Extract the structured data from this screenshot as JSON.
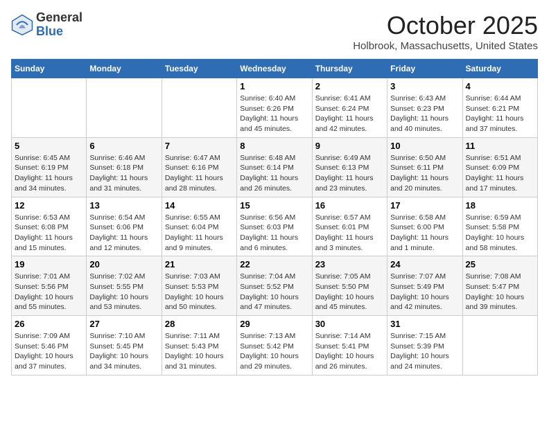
{
  "header": {
    "logo_general": "General",
    "logo_blue": "Blue",
    "month_title": "October 2025",
    "location": "Holbrook, Massachusetts, United States"
  },
  "days_of_week": [
    "Sunday",
    "Monday",
    "Tuesday",
    "Wednesday",
    "Thursday",
    "Friday",
    "Saturday"
  ],
  "weeks": [
    [
      {
        "day": "",
        "info": ""
      },
      {
        "day": "",
        "info": ""
      },
      {
        "day": "",
        "info": ""
      },
      {
        "day": "1",
        "info": "Sunrise: 6:40 AM\nSunset: 6:26 PM\nDaylight: 11 hours\nand 45 minutes."
      },
      {
        "day": "2",
        "info": "Sunrise: 6:41 AM\nSunset: 6:24 PM\nDaylight: 11 hours\nand 42 minutes."
      },
      {
        "day": "3",
        "info": "Sunrise: 6:43 AM\nSunset: 6:23 PM\nDaylight: 11 hours\nand 40 minutes."
      },
      {
        "day": "4",
        "info": "Sunrise: 6:44 AM\nSunset: 6:21 PM\nDaylight: 11 hours\nand 37 minutes."
      }
    ],
    [
      {
        "day": "5",
        "info": "Sunrise: 6:45 AM\nSunset: 6:19 PM\nDaylight: 11 hours\nand 34 minutes."
      },
      {
        "day": "6",
        "info": "Sunrise: 6:46 AM\nSunset: 6:18 PM\nDaylight: 11 hours\nand 31 minutes."
      },
      {
        "day": "7",
        "info": "Sunrise: 6:47 AM\nSunset: 6:16 PM\nDaylight: 11 hours\nand 28 minutes."
      },
      {
        "day": "8",
        "info": "Sunrise: 6:48 AM\nSunset: 6:14 PM\nDaylight: 11 hours\nand 26 minutes."
      },
      {
        "day": "9",
        "info": "Sunrise: 6:49 AM\nSunset: 6:13 PM\nDaylight: 11 hours\nand 23 minutes."
      },
      {
        "day": "10",
        "info": "Sunrise: 6:50 AM\nSunset: 6:11 PM\nDaylight: 11 hours\nand 20 minutes."
      },
      {
        "day": "11",
        "info": "Sunrise: 6:51 AM\nSunset: 6:09 PM\nDaylight: 11 hours\nand 17 minutes."
      }
    ],
    [
      {
        "day": "12",
        "info": "Sunrise: 6:53 AM\nSunset: 6:08 PM\nDaylight: 11 hours\nand 15 minutes."
      },
      {
        "day": "13",
        "info": "Sunrise: 6:54 AM\nSunset: 6:06 PM\nDaylight: 11 hours\nand 12 minutes."
      },
      {
        "day": "14",
        "info": "Sunrise: 6:55 AM\nSunset: 6:04 PM\nDaylight: 11 hours\nand 9 minutes."
      },
      {
        "day": "15",
        "info": "Sunrise: 6:56 AM\nSunset: 6:03 PM\nDaylight: 11 hours\nand 6 minutes."
      },
      {
        "day": "16",
        "info": "Sunrise: 6:57 AM\nSunset: 6:01 PM\nDaylight: 11 hours\nand 3 minutes."
      },
      {
        "day": "17",
        "info": "Sunrise: 6:58 AM\nSunset: 6:00 PM\nDaylight: 11 hours\nand 1 minute."
      },
      {
        "day": "18",
        "info": "Sunrise: 6:59 AM\nSunset: 5:58 PM\nDaylight: 10 hours\nand 58 minutes."
      }
    ],
    [
      {
        "day": "19",
        "info": "Sunrise: 7:01 AM\nSunset: 5:56 PM\nDaylight: 10 hours\nand 55 minutes."
      },
      {
        "day": "20",
        "info": "Sunrise: 7:02 AM\nSunset: 5:55 PM\nDaylight: 10 hours\nand 53 minutes."
      },
      {
        "day": "21",
        "info": "Sunrise: 7:03 AM\nSunset: 5:53 PM\nDaylight: 10 hours\nand 50 minutes."
      },
      {
        "day": "22",
        "info": "Sunrise: 7:04 AM\nSunset: 5:52 PM\nDaylight: 10 hours\nand 47 minutes."
      },
      {
        "day": "23",
        "info": "Sunrise: 7:05 AM\nSunset: 5:50 PM\nDaylight: 10 hours\nand 45 minutes."
      },
      {
        "day": "24",
        "info": "Sunrise: 7:07 AM\nSunset: 5:49 PM\nDaylight: 10 hours\nand 42 minutes."
      },
      {
        "day": "25",
        "info": "Sunrise: 7:08 AM\nSunset: 5:47 PM\nDaylight: 10 hours\nand 39 minutes."
      }
    ],
    [
      {
        "day": "26",
        "info": "Sunrise: 7:09 AM\nSunset: 5:46 PM\nDaylight: 10 hours\nand 37 minutes."
      },
      {
        "day": "27",
        "info": "Sunrise: 7:10 AM\nSunset: 5:45 PM\nDaylight: 10 hours\nand 34 minutes."
      },
      {
        "day": "28",
        "info": "Sunrise: 7:11 AM\nSunset: 5:43 PM\nDaylight: 10 hours\nand 31 minutes."
      },
      {
        "day": "29",
        "info": "Sunrise: 7:13 AM\nSunset: 5:42 PM\nDaylight: 10 hours\nand 29 minutes."
      },
      {
        "day": "30",
        "info": "Sunrise: 7:14 AM\nSunset: 5:41 PM\nDaylight: 10 hours\nand 26 minutes."
      },
      {
        "day": "31",
        "info": "Sunrise: 7:15 AM\nSunset: 5:39 PM\nDaylight: 10 hours\nand 24 minutes."
      },
      {
        "day": "",
        "info": ""
      }
    ]
  ]
}
